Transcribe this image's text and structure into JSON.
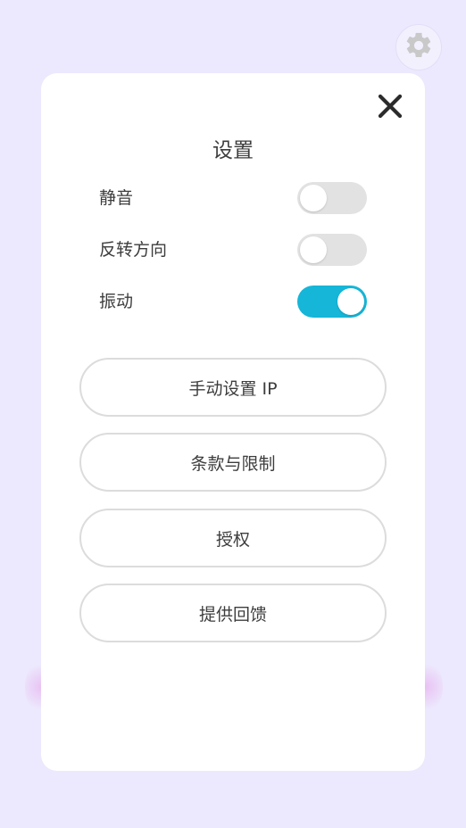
{
  "settings": {
    "title": "设置",
    "toggles": [
      {
        "label": "静音",
        "state": "off"
      },
      {
        "label": "反转方向",
        "state": "off"
      },
      {
        "label": "振动",
        "state": "on"
      }
    ],
    "buttons": [
      {
        "label": "手动设置 IP"
      },
      {
        "label": "条款与限制"
      },
      {
        "label": "授权"
      },
      {
        "label": "提供回馈"
      }
    ]
  },
  "icons": {
    "settings": "gear-icon",
    "close": "close-icon"
  },
  "colors": {
    "background": "#ece8fd",
    "panel": "#ffffff",
    "toggle_on": "#15b6d8",
    "toggle_off": "#e2e2e2",
    "gear": "#c9c9c9",
    "text": "#3d3d3d"
  }
}
